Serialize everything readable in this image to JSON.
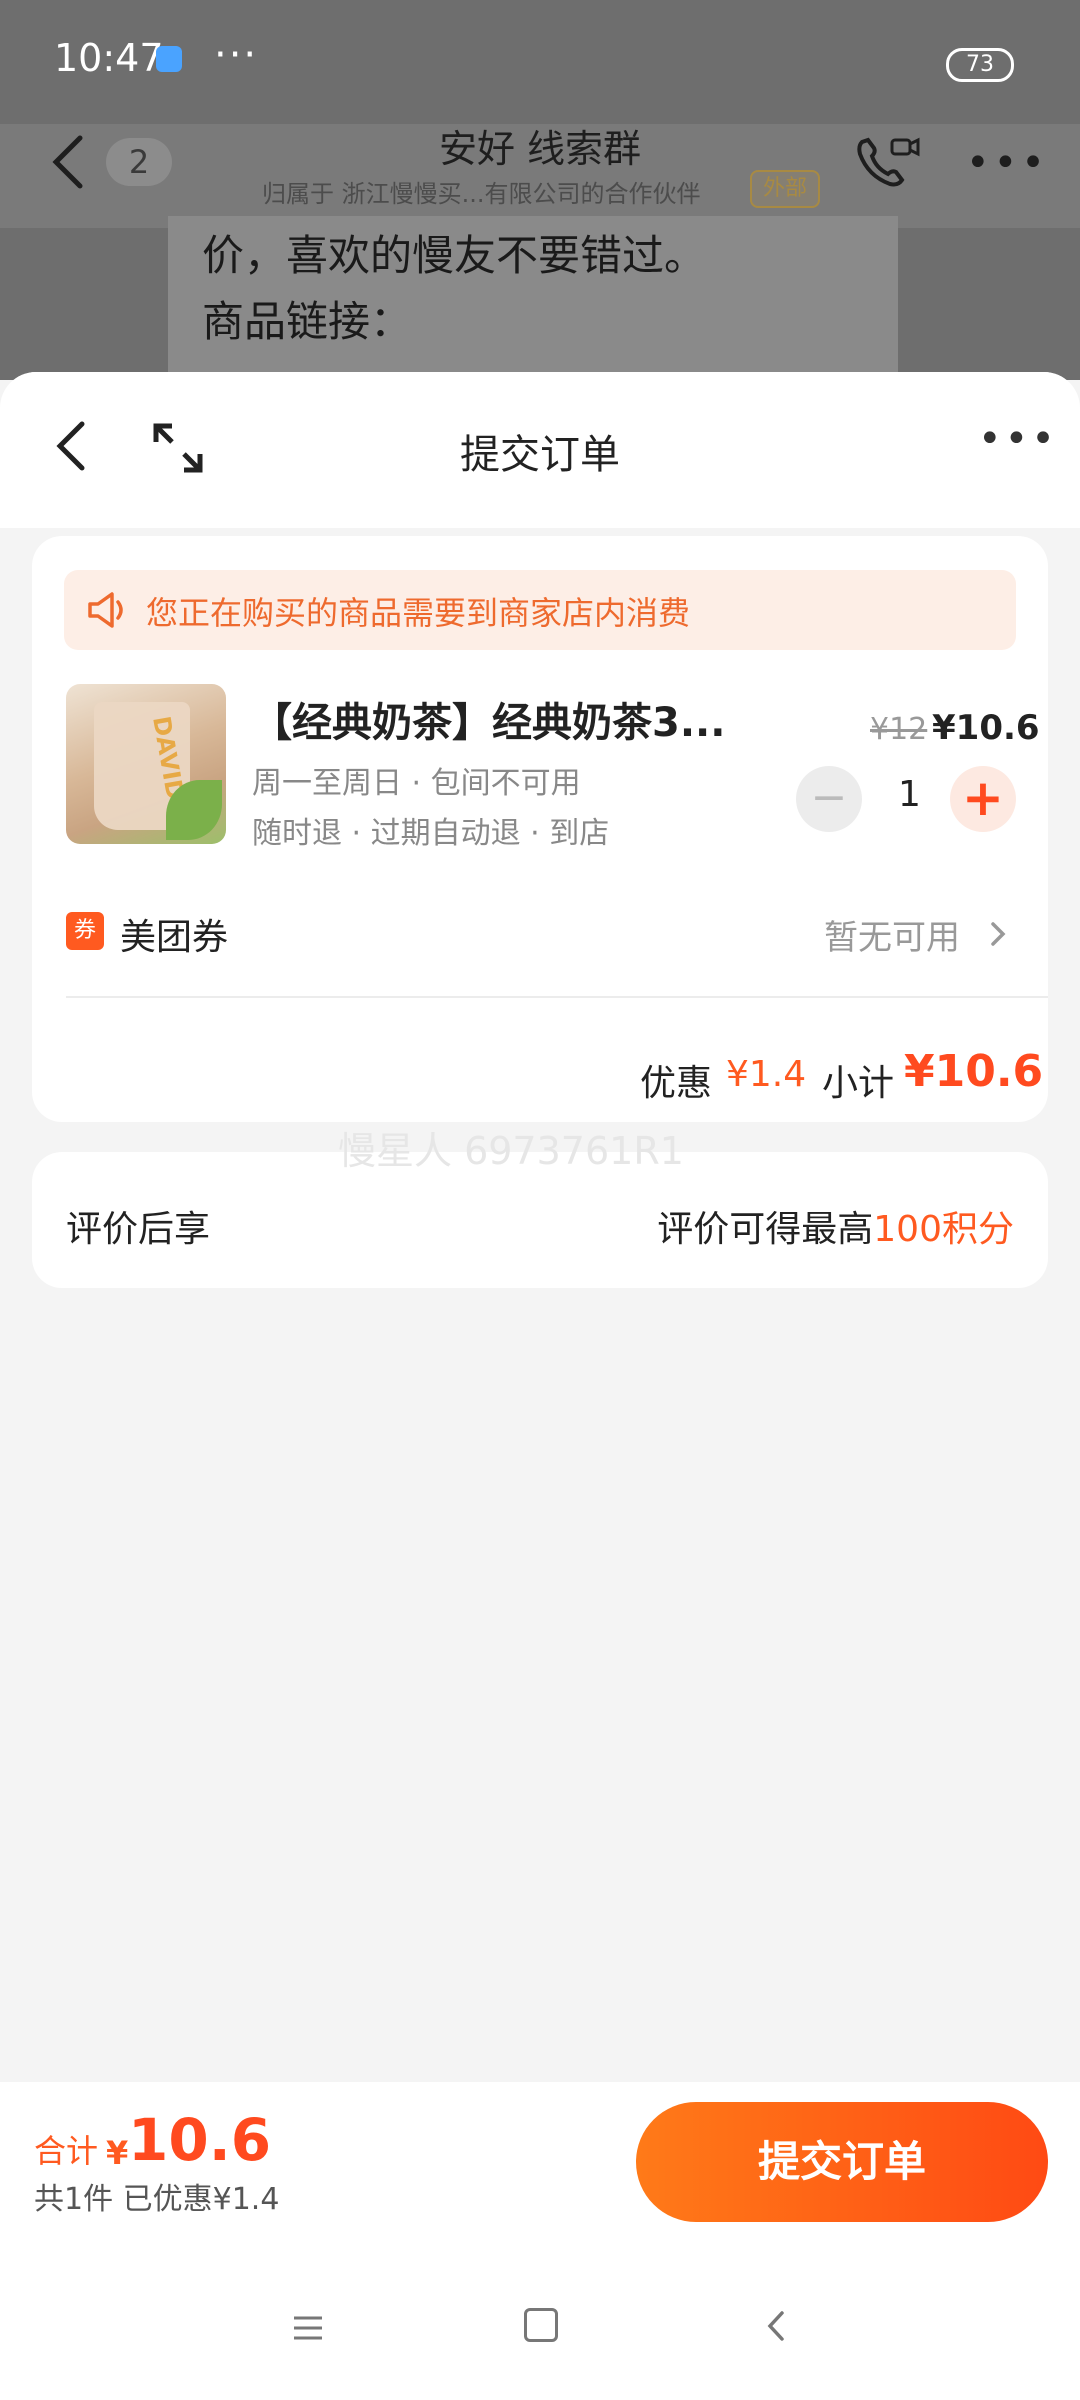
{
  "status_bar": {
    "time": "10:47",
    "more": "···",
    "battery": "73"
  },
  "chat": {
    "unread_count": "2",
    "title": "安好 线索群",
    "subtitle": "归属于 浙江慢慢买...有限公司的合作伙伴",
    "external_tag": "外部",
    "message_line1": "价，喜欢的慢友不要错过。",
    "message_line2": "商品链接："
  },
  "sheet": {
    "title": "提交订单",
    "notice": "您正在购买的商品需要到商家店内消费",
    "product": {
      "title": "【经典奶茶】经典奶茶3...",
      "spec1": "周一至周日 · 包间不可用",
      "spec2": "随时退 · 过期自动退 · 到店",
      "original_price": "¥12",
      "price": "¥10.6",
      "quantity": "1",
      "minus": "−",
      "plus": "+",
      "thumb_text": "DAVID"
    },
    "coupon": {
      "icon_text": "券",
      "label": "美团券",
      "value": "暂无可用"
    },
    "discount_label": "优惠",
    "discount_value": "¥1.4",
    "subtotal_label": "小计",
    "subtotal_value": "¥10.6",
    "watermark": "慢星人 6973761R1",
    "review": {
      "label": "评价后享",
      "text": "评价可得最高",
      "points": "100积分"
    }
  },
  "bottom": {
    "total_label": "合计",
    "total_yen": "¥",
    "total_value": "10.6",
    "summary": "共1件  已优惠¥1.4",
    "submit": "提交订单"
  }
}
